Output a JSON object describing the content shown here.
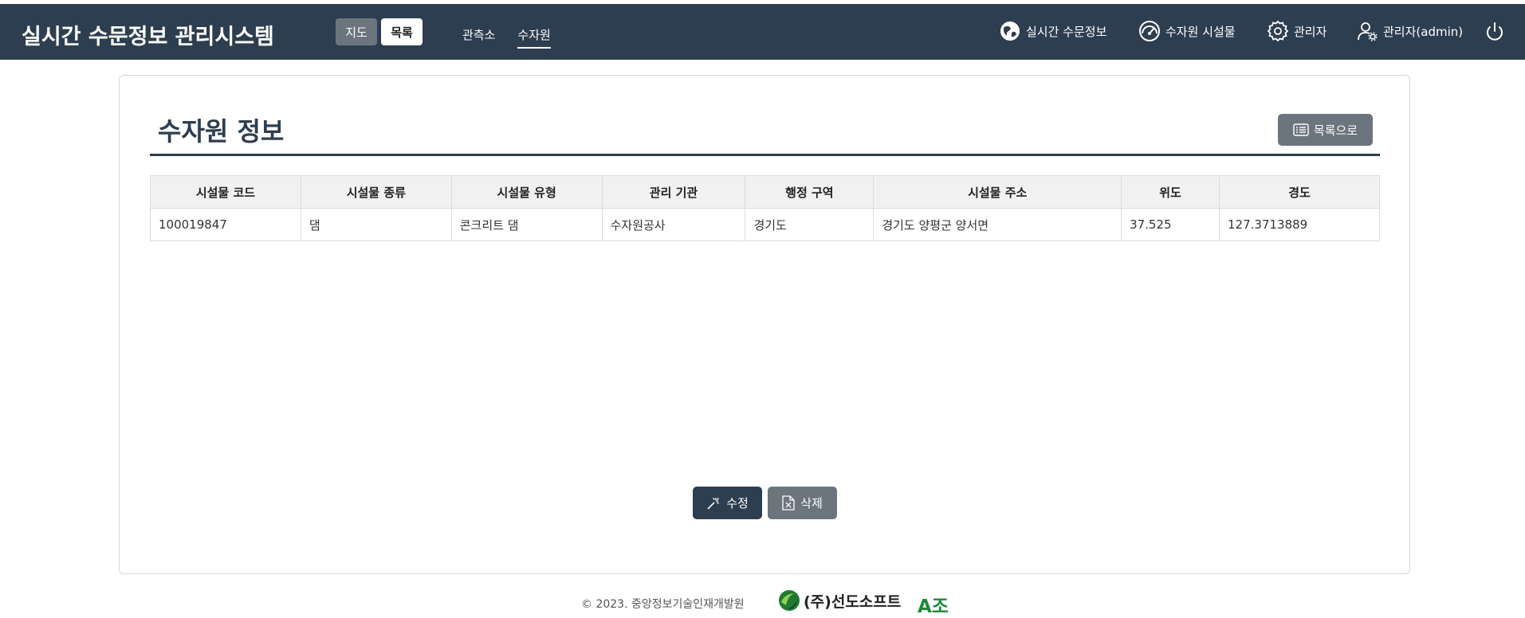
{
  "header": {
    "app_title": "실시간 수문정보 관리시스템",
    "view_toggle": {
      "map": "지도",
      "list": "목록"
    },
    "nav": [
      {
        "label": "관측소"
      },
      {
        "label": "수자원"
      }
    ],
    "utility": {
      "realtime": "실시간 수문정보",
      "facilities": "수자원 시설물",
      "admin": "관리자",
      "user": "관리자(admin)"
    }
  },
  "page": {
    "title": "수자원 정보",
    "back_button": "목록으로"
  },
  "table": {
    "headers": [
      "시설물 코드",
      "시설물 종류",
      "시설물 유형",
      "관리 기관",
      "행정 구역",
      "시설물 주소",
      "위도",
      "경도"
    ],
    "row": [
      "100019847",
      "댐",
      "콘크리트 댐",
      "수자원공사",
      "경기도",
      "경기도 양평군 양서면",
      "37.525",
      "127.3713889"
    ]
  },
  "actions": {
    "edit": "수정",
    "delete": "삭제"
  },
  "footer": {
    "copyright": "© 2023. 중앙정보기술인재개발원",
    "company": "(주)선도소프트",
    "team": "A조"
  },
  "colors": {
    "header_bg": "#2e3e51",
    "secondary": "#6c757d",
    "team_green": "#1f8a3a"
  }
}
